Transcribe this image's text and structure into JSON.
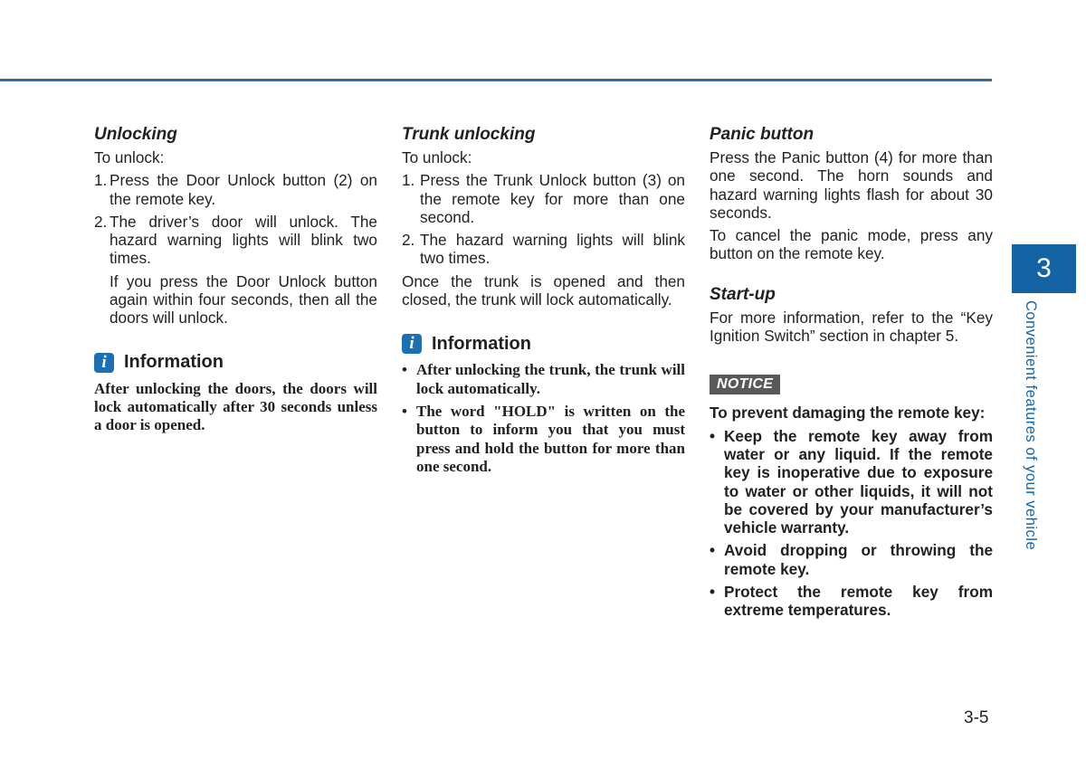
{
  "page": {
    "chapter_number": "3",
    "chapter_title": "Convenient features of your vehicle",
    "page_number": "3-5",
    "accent_color": "#1464a5"
  },
  "col1": {
    "heading": "Unlocking",
    "intro": "To unlock:",
    "steps": [
      {
        "num": "1.",
        "text": "Press the Door Unlock button (2) on the remote key."
      },
      {
        "num": "2.",
        "text": "The driver’s door will unlock. The hazard warning lights will blink two times."
      }
    ],
    "step_note": "If you press the Door Unlock button again within four seconds, then all the doors will unlock.",
    "info": {
      "icon": "i",
      "title": "Information",
      "text": "After unlocking the doors, the doors will lock automatically after 30 seconds unless a door is opened."
    }
  },
  "col2": {
    "heading": "Trunk unlocking",
    "intro": "To unlock:",
    "steps": [
      {
        "num": "1.",
        "text": "Press the Trunk Unlock button (3) on the remote key for more than one second."
      },
      {
        "num": "2.",
        "text": "The hazard warning lights will blink two times."
      }
    ],
    "closing": "Once the trunk is opened and then closed, the trunk will lock automatically.",
    "info": {
      "icon": "i",
      "title": "Information",
      "bullets": [
        "After unlocking the trunk, the trunk will lock automatically.",
        "The word \"HOLD\" is written on the button to inform you that you must press and hold the button for more than one second."
      ]
    }
  },
  "col3": {
    "panic_heading": "Panic button",
    "panic_text_1": "Press the Panic button (4) for more than one second. The horn sounds and hazard warning lights flash for about 30 seconds.",
    "panic_text_2": "To cancel the panic mode, press any button on the remote key.",
    "startup_heading": "Start-up",
    "startup_text": "For more information, refer to the “Key Ignition Switch” section in chapter 5.",
    "notice": {
      "label": "NOTICE",
      "intro": "To prevent damaging the remote key:",
      "bullets": [
        "Keep the remote key away from water or any liquid. If the remote key is inoperative due to exposure to water or other liquids, it will not be covered by your manufacturer’s vehicle warranty.",
        "Avoid dropping or throwing the remote key.",
        "Protect the remote key from extreme temperatures."
      ]
    }
  },
  "glyphs": {
    "bullet": "•"
  }
}
